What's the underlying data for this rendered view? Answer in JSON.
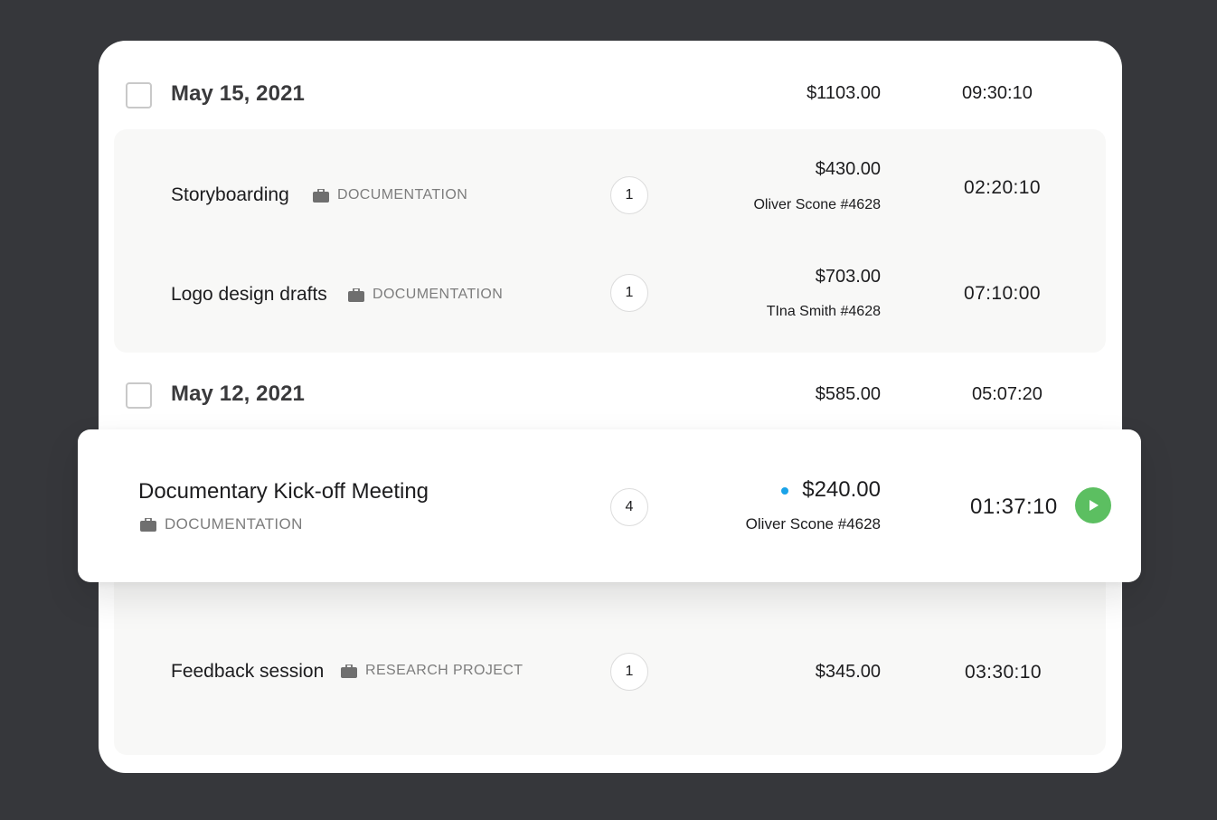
{
  "groups": [
    {
      "date": "May 15, 2021",
      "amount": "$1103.00",
      "time": "09:30:10",
      "entries": [
        {
          "name": "Storyboarding",
          "tag": "DOCUMENTATION",
          "count": "1",
          "amount": "$430.00",
          "person": "Oliver Scone #4628",
          "time": "02:20:10"
        },
        {
          "name": "Logo design drafts",
          "tag": "DOCUMENTATION",
          "count": "1",
          "amount": "$703.00",
          "person": "TIna Smith #4628",
          "time": "07:10:00"
        }
      ]
    },
    {
      "date": "May 12, 2021",
      "amount": "$585.00",
      "time": "05:07:20",
      "entries": [
        {
          "name": "Documentary Kick-off Meeting",
          "tag": "DOCUMENTATION",
          "count": "4",
          "amount": "$240.00",
          "person": "Oliver Scone #4628",
          "time": "01:37:10"
        },
        {
          "name": "Feedback session",
          "tag": "RESEARCH PROJECT",
          "count": "1",
          "amount": "$345.00",
          "time": "03:30:10"
        }
      ]
    }
  ],
  "icons": {
    "tag": "briefcase-icon",
    "play": "play-icon",
    "status": "status-dot"
  },
  "colors": {
    "background": "#36373b",
    "card": "#ffffff",
    "play": "#5cbf61",
    "status_dot": "#1aa3e8",
    "tag_text": "#7d7d7d"
  }
}
